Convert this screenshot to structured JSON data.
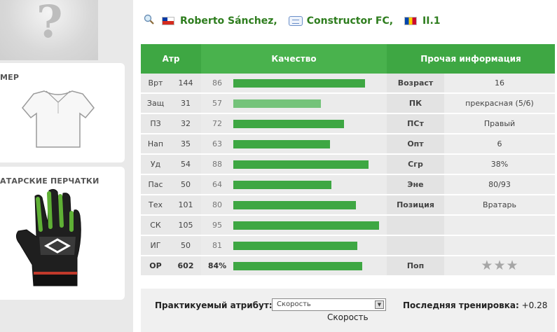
{
  "header": {
    "player_name": "Roberto Sánchez,",
    "club_name": "Constructor FC,",
    "league": "II.1"
  },
  "sidebar": {
    "shirt_title": "МЕР",
    "gloves_title": "АТАРСКИЕ ПЕРЧАТКИ"
  },
  "table": {
    "headers": {
      "atr": "Атр",
      "quality": "Качество",
      "info": "Прочая информация"
    },
    "rows": [
      {
        "name": "Врт",
        "value": "144",
        "quality": 86,
        "info_name": "Возраст",
        "info_value": "16"
      },
      {
        "name": "Защ",
        "value": "31",
        "quality": 57,
        "info_name": "ПК",
        "info_value": "прекрасная (5/6)",
        "light": true
      },
      {
        "name": "ПЗ",
        "value": "32",
        "quality": 72,
        "info_name": "ПСт",
        "info_value": "Правый"
      },
      {
        "name": "Нап",
        "value": "35",
        "quality": 63,
        "info_name": "Опт",
        "info_value": "6"
      },
      {
        "name": "Уд",
        "value": "54",
        "quality": 88,
        "info_name": "Сгр",
        "info_value": "38%"
      },
      {
        "name": "Пас",
        "value": "50",
        "quality": 64,
        "info_name": "Эне",
        "info_value": "80/93"
      },
      {
        "name": "Тех",
        "value": "101",
        "quality": 80,
        "info_name": "Позиция",
        "info_value": "Вратарь"
      },
      {
        "name": "СК",
        "value": "105",
        "quality": 95,
        "info_name": "",
        "info_value": ""
      },
      {
        "name": "ИГ",
        "value": "50",
        "quality": 81,
        "info_name": "",
        "info_value": ""
      }
    ],
    "total": {
      "name": "ОР",
      "value": "602",
      "quality_label": "84%",
      "quality": 84,
      "info_name": "Поп",
      "stars": 3
    }
  },
  "training": {
    "label": "Практикуемый атрибут:",
    "select_value": "Скорость",
    "selected_text": "Скорость",
    "last_label": "Последняя тренировка:",
    "last_value": "+0.28"
  },
  "colors": {
    "accent": "#3ea743",
    "bar_light": "#74c37a",
    "link": "#2e7d1e"
  }
}
